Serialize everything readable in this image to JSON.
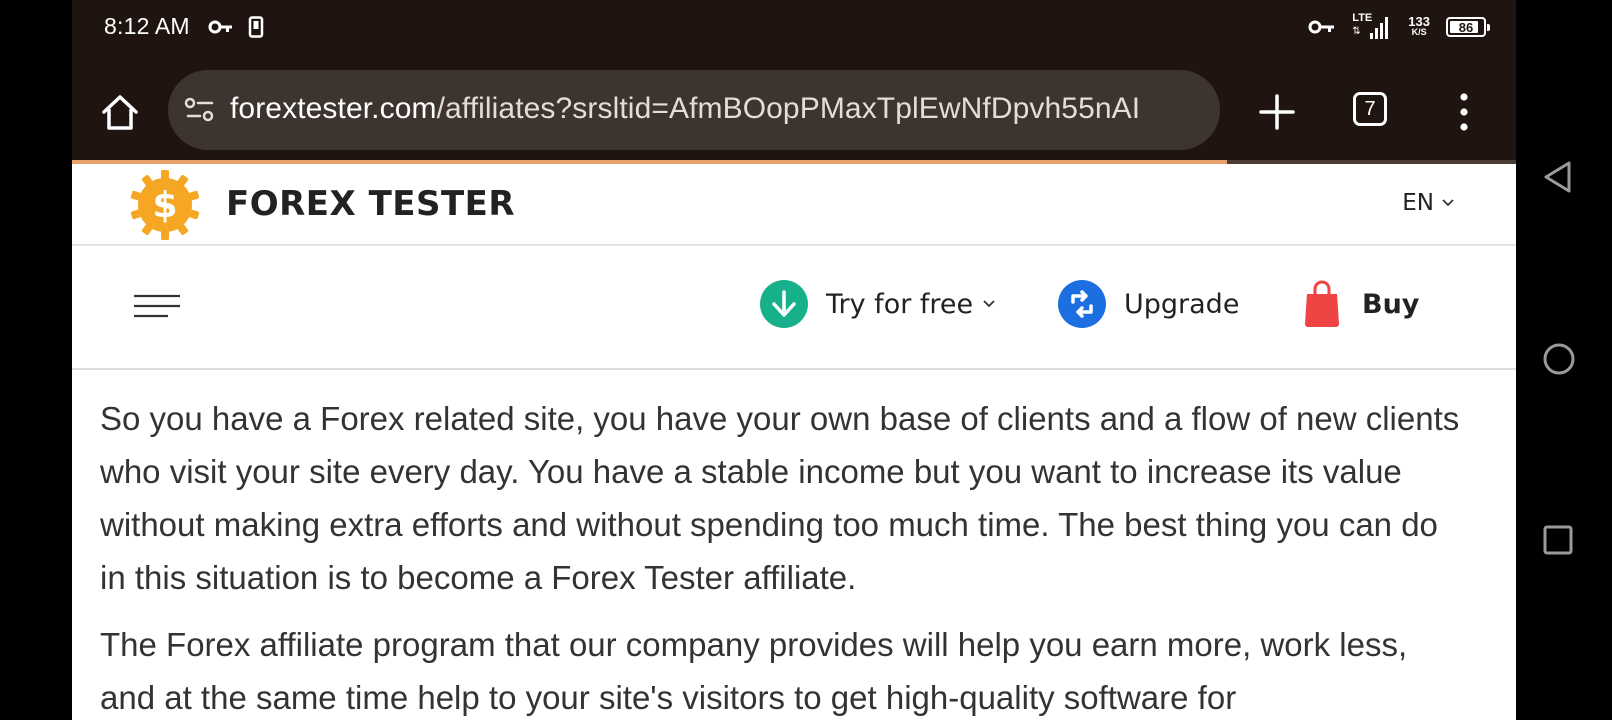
{
  "status_bar": {
    "time": "8:12 AM",
    "network": "LTE",
    "speed_value": "133",
    "speed_unit": "K/S",
    "battery": "86"
  },
  "browser": {
    "url_host": "forextester.com",
    "url_path": "/affiliates?srsltid=AfmBOopPMaxTplEwNfDpvh55nAI",
    "tab_count": "7",
    "load_progress": 0.8
  },
  "site": {
    "brand": "FOREX TESTER",
    "language": "EN",
    "nav": {
      "try_label": "Try for free",
      "upgrade_label": "Upgrade",
      "buy_label": "Buy"
    }
  },
  "content": {
    "paragraphs": [
      "So you have a Forex related site, you have your own base of clients and a flow of new clients who visit your site every day. You have a stable income but you want to increase its value without making extra efforts and without spending too much time. The best thing you can do in this situation is to become a Forex Tester affiliate.",
      "The Forex affiliate program that our company provides will help you earn more, work less, and at the same time help to your site's visitors to get high-quality software for"
    ]
  },
  "colors": {
    "browser_chrome": "#1f1410",
    "try_icon": "#16b08a",
    "upgrade_icon": "#1b6fe0",
    "buy_icon": "#ef4444",
    "logo": "#f5a623"
  }
}
